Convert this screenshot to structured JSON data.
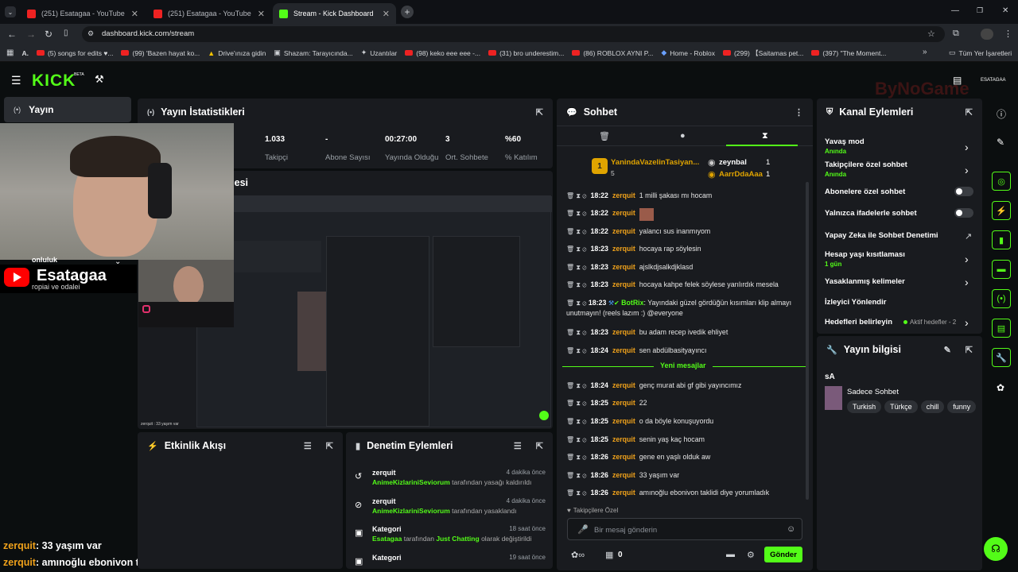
{
  "browser": {
    "tabs": [
      {
        "title": "(251) Esatagaa - YouTube"
      },
      {
        "title": "(251) Esatagaa - YouTube"
      },
      {
        "title": "Stream - Kick Dashboard"
      }
    ],
    "url": "dashboard.kick.com/stream",
    "bookmarks": [
      "(5) songs for edits ♥...",
      "(99) 'Bazen hayat ko...",
      "Drive'ınıza gidin",
      "Shazam: Tarayıcında...",
      "Uzantılar",
      "(98) keko eee eee -...",
      "(31) bro underestim...",
      "(86) ROBLOX AYNI P...",
      "Home - Roblox",
      "(299) 【Saitamas pet...",
      "(397) \"The Moment..."
    ],
    "all_bookmarks": "Tüm Yer İşaretleri"
  },
  "kick": {
    "logo": "KICK",
    "beta": "BETA",
    "side_user": "ESATAGAA",
    "watermark": "ByNoGame"
  },
  "sidebar": {
    "stream_label": "Yayın"
  },
  "stats": {
    "title": "Yayın İstatistikleri",
    "items": [
      {
        "value": "1.033",
        "label": "Takipçi"
      },
      {
        "value": "-",
        "label": "Abone Sayısı"
      },
      {
        "value": "00:27:00",
        "label": "Yayında Olduğu"
      },
      {
        "value": "3",
        "label": "Ort. Sohbete"
      },
      {
        "value": "%60",
        "label": "% Katılım"
      }
    ]
  },
  "preview": {
    "title_fragment": "nesi"
  },
  "activity": {
    "title": "Etkinlik Akışı"
  },
  "moderation": {
    "title": "Denetim Eylemleri",
    "items": [
      {
        "name": "zerquit",
        "time": "4 dakika önce",
        "actor": "AnimeKizlariniSeviorum",
        "text": "tarafından yasağı kaldırıldı"
      },
      {
        "name": "zerquit",
        "time": "4 dakika önce",
        "actor": "AnimeKizlariniSeviorum",
        "text": "tarafından yasaklandı"
      },
      {
        "name": "Kategori",
        "time": "18 saat önce",
        "actor": "Esatagaa",
        "text": "tarafından",
        "cat": "Just Chatting",
        "text2": "olarak değiştirildi"
      },
      {
        "name": "Kategori",
        "time": "19 saat önce"
      }
    ]
  },
  "chat": {
    "title": "Sohbet",
    "top": {
      "first_user": "YanindaVazelinTasiyan...",
      "first_count": "5",
      "second_user": "zeynbal",
      "second_count": "1",
      "third_user": "AarrDdaAaa",
      "third_count": "1"
    },
    "messages": [
      {
        "time": "18:22",
        "user": "zerquit",
        "text": "1 milli şakası mı hocam"
      },
      {
        "time": "18:22",
        "user": "zerquit",
        "text": ""
      },
      {
        "time": "18:22",
        "user": "zerquit",
        "text": "yalancı sus inanmıyom"
      },
      {
        "time": "18:23",
        "user": "zerquit",
        "text": "hocaya rap söylesin"
      },
      {
        "time": "18:23",
        "user": "zerquit",
        "text": "ajslkdjsalkdjklasd"
      },
      {
        "time": "18:23",
        "user": "zerquit",
        "text": "hocaya kahpe felek söylese yarılırdık mesela"
      },
      {
        "time": "18:23",
        "user": "BotRix",
        "text": "Yayındaki güzel gördüğün kısımları klip almayı unutmayın! (reels lazım :) @everyone"
      },
      {
        "time": "18:23",
        "user": "zerquit",
        "text": "bu adam recep ivedik ehliyet"
      },
      {
        "time": "18:24",
        "user": "zerquit",
        "text": "sen abdülbasityayıncı"
      },
      {
        "time": "18:24",
        "user": "zerquit",
        "text": "genç murat abi gf gibi yayıncımız"
      },
      {
        "time": "18:25",
        "user": "zerquit",
        "text": "22"
      },
      {
        "time": "18:25",
        "user": "zerquit",
        "text": "o da böyle konuşuyordu"
      },
      {
        "time": "18:25",
        "user": "zerquit",
        "text": "senin yaş kaç hocam"
      },
      {
        "time": "18:26",
        "user": "zerquit",
        "text": "gene en yaşlı olduk aw"
      },
      {
        "time": "18:26",
        "user": "zerquit",
        "text": "33 yaşım var"
      },
      {
        "time": "18:26",
        "user": "zerquit",
        "text": "amınoğlu ebonivon taklidi diye yorumladık"
      }
    ],
    "new_messages": "Yeni mesajlar",
    "followers_only": "Takipçilere Özel",
    "input_placeholder": "Bir mesaj gönderin",
    "send": "Gönder",
    "count": "0"
  },
  "channel_actions": {
    "title": "Kanal Eylemleri",
    "items": [
      {
        "label": "Yavaş mod",
        "sub": "Anında"
      },
      {
        "label": "Takipçilere özel sohbet",
        "sub": "Anında"
      },
      {
        "label": "Abonelere özel sohbet"
      },
      {
        "label": "Yalnızca ifadelerle sohbet"
      },
      {
        "label": "Yapay Zeka ile Sohbet Denetimi"
      },
      {
        "label": "Hesap yaşı kısıtlaması",
        "sub": "1 gün"
      },
      {
        "label": "Yasaklanmış kelimeler"
      },
      {
        "label": "İzleyici Yönlendir"
      },
      {
        "label": "Hedefleri belirleyin",
        "extra": "Aktif hedefler - 2"
      }
    ]
  },
  "stream_info": {
    "title": "Yayın bilgisi",
    "stream_title": "sA",
    "category": "Sadece Sohbet",
    "tags": [
      "Turkish",
      "Türkçe",
      "chill",
      "funny"
    ]
  },
  "overlay": {
    "yt_name": "Esatagaa",
    "partial1": "onluluk",
    "partial2": "ropiai ve odalei",
    "chat_lines": [
      {
        "user": "zerquit",
        "text": ": 33 yaşım var"
      },
      {
        "user": "zerquit",
        "text": ": amınoğlu ebonivon taklidi diye yorumladık"
      }
    ],
    "mini_footer": "zerquit : 33 yaşım var"
  },
  "colors": {
    "kick_green": "#53fc18",
    "username": "#f0a21b",
    "panel": "#191b1f",
    "bg": "#0b0e0f"
  }
}
